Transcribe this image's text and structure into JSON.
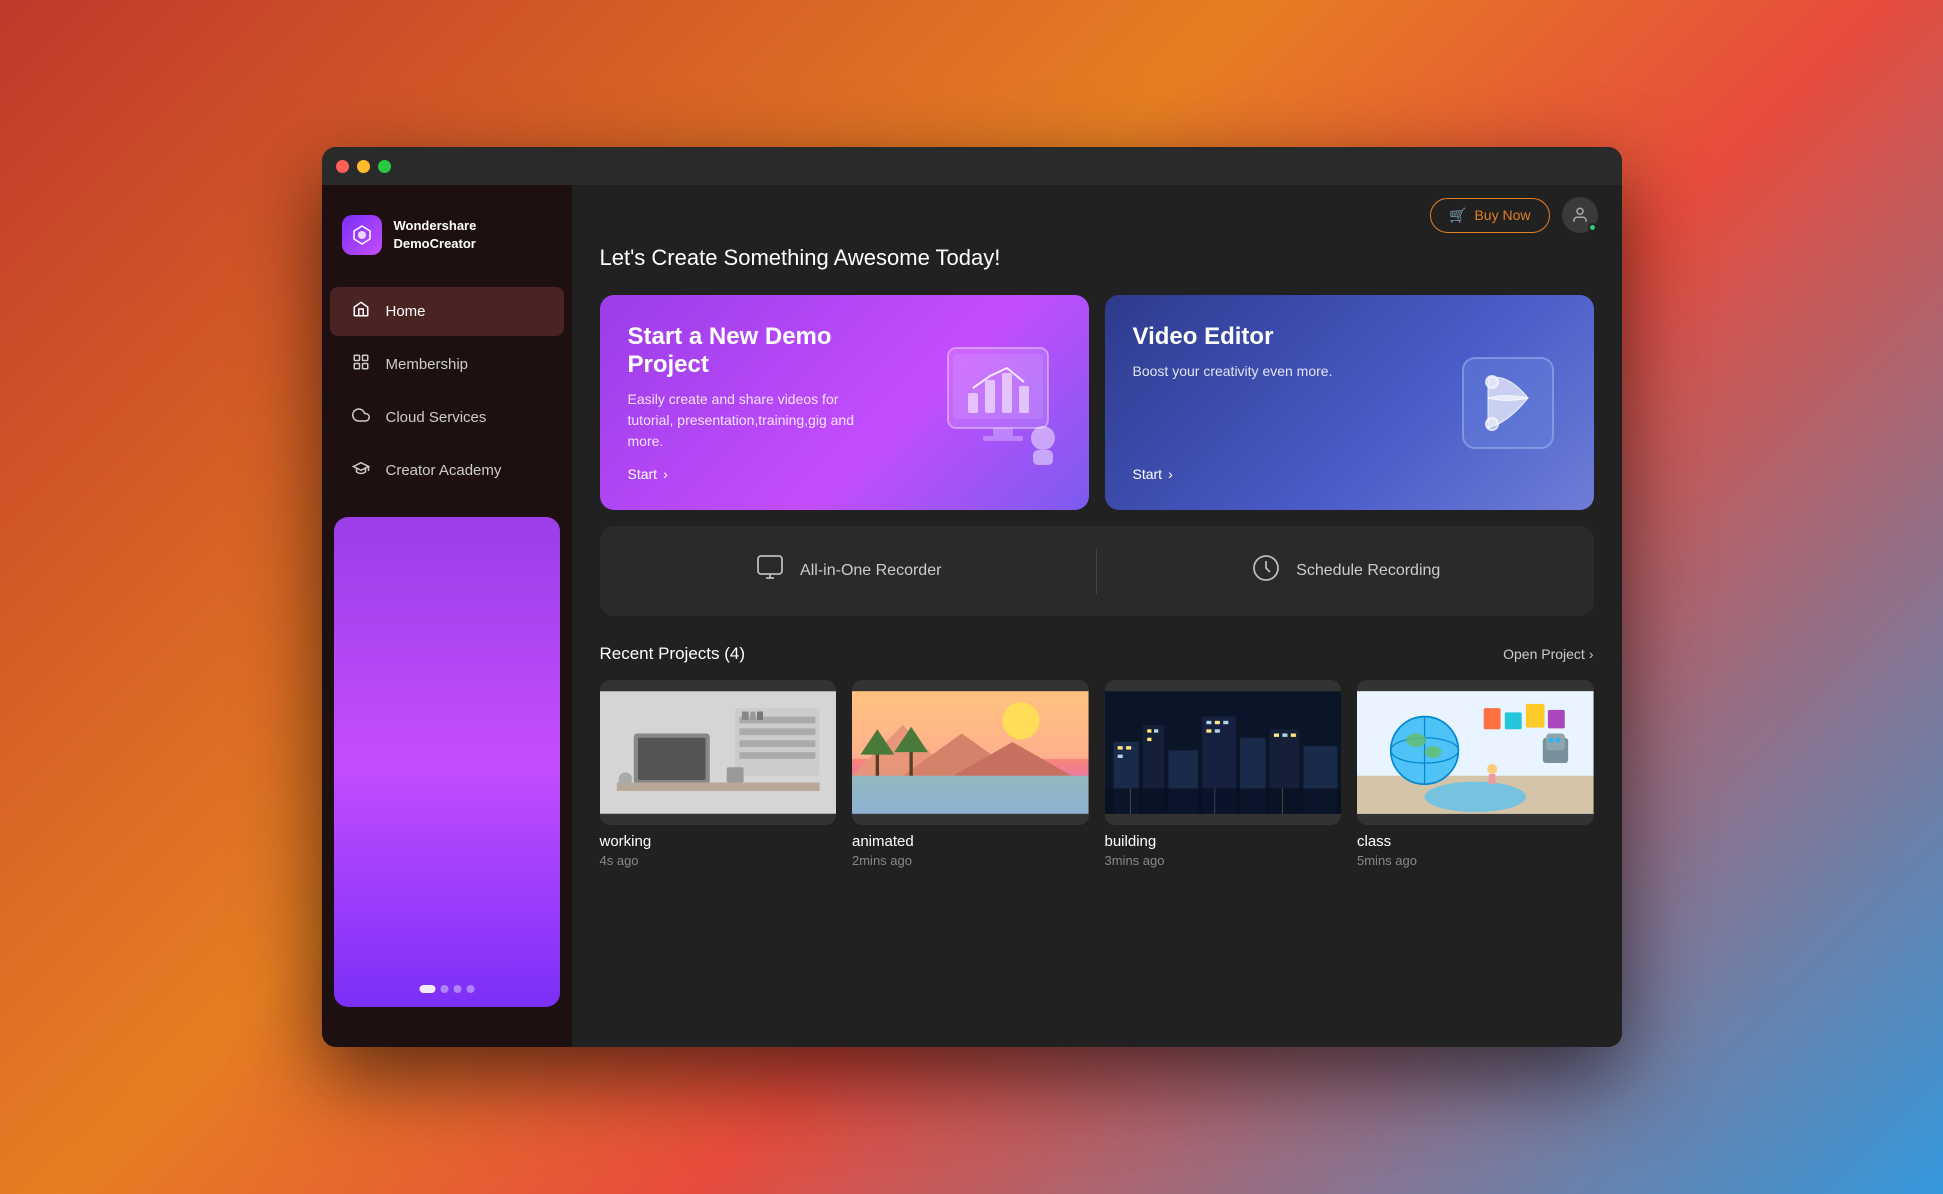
{
  "window": {
    "title": "Wondershare DemoCreator"
  },
  "topbar": {
    "buy_now_label": "Buy Now",
    "cart_icon": "🛒"
  },
  "sidebar": {
    "logo_text_line1": "Wondershare",
    "logo_text_line2": "DemoCreator",
    "nav_items": [
      {
        "id": "home",
        "label": "Home",
        "icon": "⌂",
        "active": true
      },
      {
        "id": "membership",
        "label": "Membership",
        "icon": "⊞",
        "active": false
      },
      {
        "id": "cloud-services",
        "label": "Cloud Services",
        "icon": "☁",
        "active": false
      },
      {
        "id": "creator-academy",
        "label": "Creator Academy",
        "icon": "🎓",
        "active": false
      }
    ]
  },
  "main": {
    "page_title": "Let's Create Something Awesome Today!",
    "hero_cards": [
      {
        "id": "demo-project",
        "title": "Start a New Demo Project",
        "description": "Easily create and share videos for tutorial, presentation,training,gig and more.",
        "start_label": "Start"
      },
      {
        "id": "video-editor",
        "title": "Video Editor",
        "description": "Boost your creativity even more.",
        "start_label": "Start"
      }
    ],
    "recorder_items": [
      {
        "id": "all-in-one",
        "label": "All-in-One Recorder"
      },
      {
        "id": "schedule",
        "label": "Schedule Recording"
      }
    ],
    "recent_section": {
      "title": "Recent Projects (4)",
      "open_project_label": "Open Project",
      "projects": [
        {
          "id": 1,
          "name": "working",
          "time": "4s ago",
          "thumb_type": "office"
        },
        {
          "id": 2,
          "name": "animated",
          "time": "2mins ago",
          "thumb_type": "landscape"
        },
        {
          "id": 3,
          "name": "building",
          "time": "3mins ago",
          "thumb_type": "city"
        },
        {
          "id": 4,
          "name": "class",
          "time": "5mins ago",
          "thumb_type": "classroom"
        }
      ]
    }
  }
}
